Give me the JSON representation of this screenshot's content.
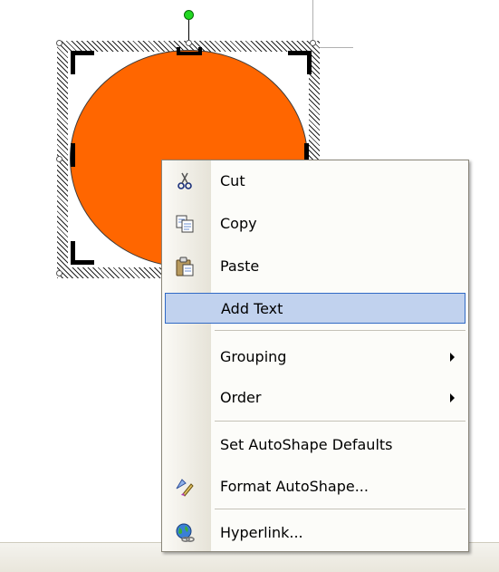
{
  "context_menu": {
    "items": [
      {
        "label": "Cut",
        "icon": "scissors-icon"
      },
      {
        "label": "Copy",
        "icon": "copy-icon"
      },
      {
        "label": "Paste",
        "icon": "paste-icon"
      },
      {
        "label": "Add Text",
        "highlighted": true
      },
      {
        "label": "Grouping",
        "submenu": true
      },
      {
        "label": "Order",
        "submenu": true
      },
      {
        "label": "Set AutoShape Defaults"
      },
      {
        "label": "Format AutoShape...",
        "icon": "format-autoshape-icon"
      },
      {
        "label": "Hyperlink...",
        "icon": "hyperlink-globe-icon"
      }
    ]
  },
  "shape": {
    "type": "oval",
    "fill_color": "#ff6600",
    "selected": true
  },
  "colors": {
    "menu_highlight": "#c1d2ee",
    "menu_highlight_border": "#316ac5",
    "rotation_handle": "#22d822"
  }
}
